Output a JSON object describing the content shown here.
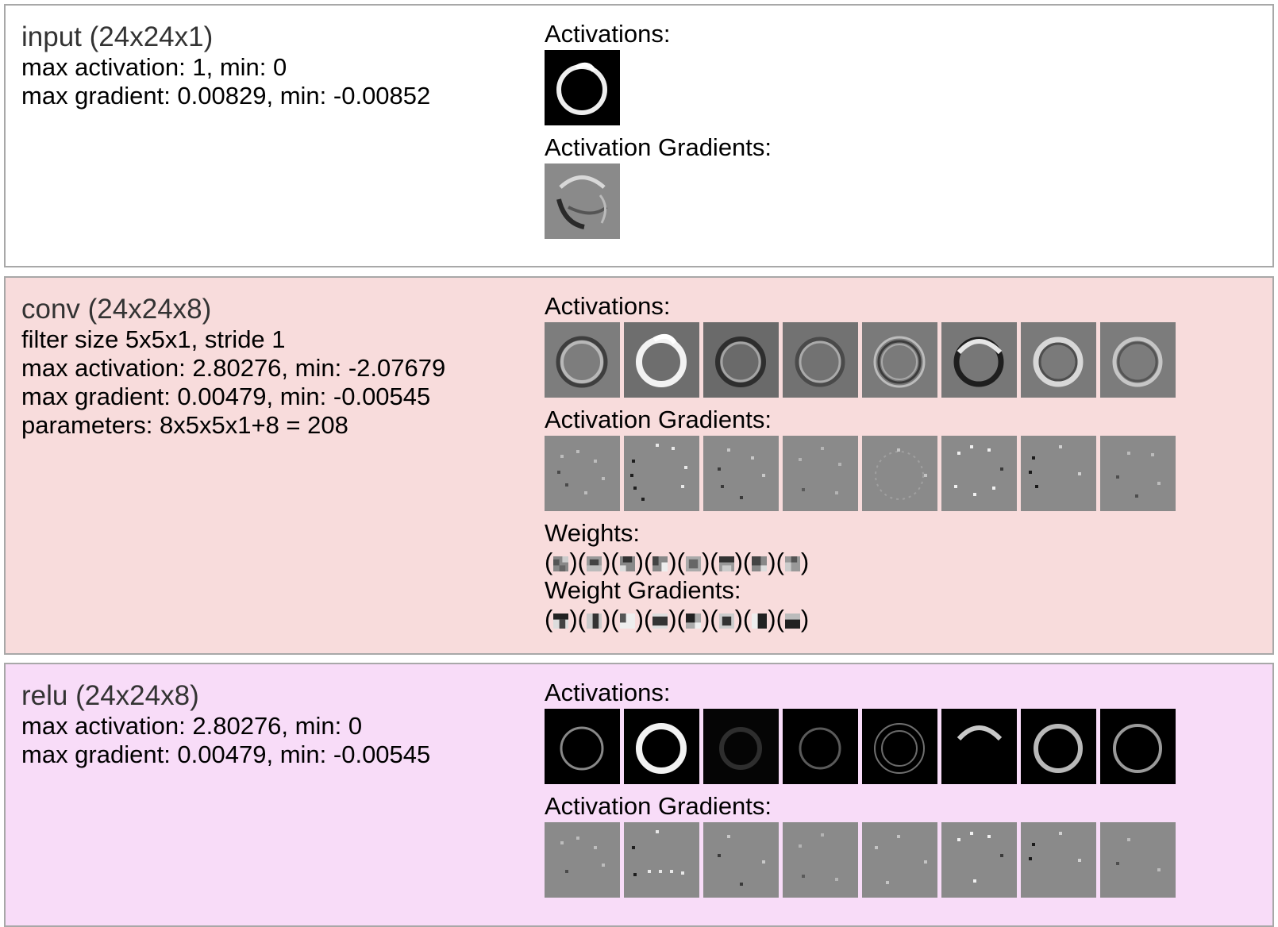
{
  "layers": [
    {
      "title": "input (24x24x1)",
      "bg": "#ffffff",
      "stats": [
        "max activation: 1, min: 0",
        "max gradient: 0.00829, min: -0.00852"
      ],
      "activations_label": "Activations:",
      "gradients_label": "Activation Gradients:"
    },
    {
      "title": "conv (24x24x8)",
      "bg": "#f8dcdc",
      "stats": [
        "filter size 5x5x1, stride 1",
        "max activation: 2.80276, min: -2.07679",
        "max gradient: 0.00479, min: -0.00545",
        "parameters: 8x5x5x1+8 = 208"
      ],
      "activations_label": "Activations:",
      "gradients_label": "Activation Gradients:",
      "weights_label": "Weights:",
      "weight_gradients_label": "Weight Gradients:"
    },
    {
      "title": "relu (24x24x8)",
      "bg": "#f8dcf8",
      "stats": [
        "max activation: 2.80276, min: 0",
        "max gradient: 0.00479, min: -0.00545"
      ],
      "activations_label": "Activations:",
      "gradients_label": "Activation Gradients:"
    }
  ],
  "colors": {
    "border": "#a8a8a8",
    "title_text": "#333333"
  }
}
